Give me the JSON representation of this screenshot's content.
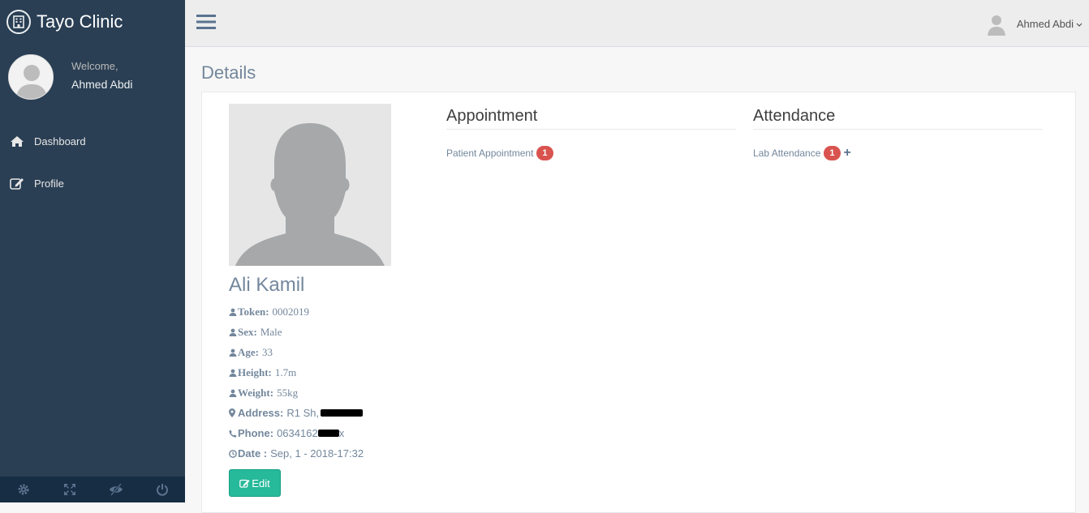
{
  "app": {
    "title": "Tayo Clinic"
  },
  "sidebar": {
    "welcome": "Welcome,",
    "user_name": "Ahmed Abdi",
    "nav": [
      {
        "label": "Dashboard",
        "icon": "home-icon"
      },
      {
        "label": "Profile",
        "icon": "edit-icon"
      }
    ],
    "footer": [
      "gear-icon",
      "fullscreen-icon",
      "eye-slash-icon",
      "power-icon"
    ]
  },
  "topnav": {
    "user_name": "Ahmed Abdi"
  },
  "page": {
    "title": "Details"
  },
  "patient": {
    "name": "Ali Kamil",
    "fields": [
      {
        "label": "Token:",
        "value": "0002019"
      },
      {
        "label": "Sex:",
        "value": "Male"
      },
      {
        "label": "Age:",
        "value": "33"
      },
      {
        "label": "Height:",
        "value": "1.7m"
      },
      {
        "label": "Weight:",
        "value": "55kg"
      },
      {
        "label": "Address:",
        "value": "R1 Sh,"
      },
      {
        "label": "Phone:",
        "value": "0634162",
        "suffix": "x"
      },
      {
        "label": "Date :",
        "value": "Sep, 1 - 2018-17:32"
      }
    ],
    "edit_label": "Edit"
  },
  "appointment": {
    "title": "Appointment",
    "item_label": "Patient Appointment",
    "count": "1"
  },
  "attendance": {
    "title": "Attendance",
    "item_label": "Lab Attendance",
    "count": "1",
    "add": "+"
  },
  "colors": {
    "sidebar": "#2a3f54",
    "accent": "#26b99a",
    "badge": "#d9534f",
    "text_muted": "#73879c"
  }
}
